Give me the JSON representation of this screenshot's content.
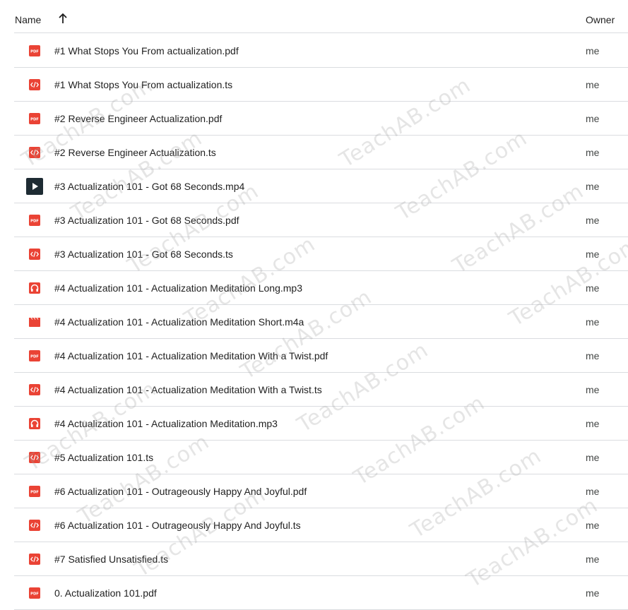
{
  "header": {
    "name_label": "Name",
    "owner_label": "Owner",
    "sort_icon": "arrow-up-icon"
  },
  "colors": {
    "pdf": "#ea4335",
    "code": "#ea4335",
    "audio": "#ea4335",
    "video_bg": "#1e2b33",
    "divider": "#dadce0"
  },
  "files": [
    {
      "name": "#1 What Stops You From actualization.pdf",
      "type": "pdf",
      "owner": "me"
    },
    {
      "name": "#1 What Stops You From actualization.ts",
      "type": "code",
      "owner": "me"
    },
    {
      "name": "#2 Reverse Engineer Actualization.pdf",
      "type": "pdf",
      "owner": "me"
    },
    {
      "name": "#2 Reverse Engineer Actualization.ts",
      "type": "code",
      "owner": "me"
    },
    {
      "name": "#3 Actualization 101 - Got 68 Seconds.mp4",
      "type": "video",
      "owner": "me"
    },
    {
      "name": "#3 Actualization 101 - Got 68 Seconds.pdf",
      "type": "pdf",
      "owner": "me"
    },
    {
      "name": "#3 Actualization 101 - Got 68 Seconds.ts",
      "type": "code",
      "owner": "me"
    },
    {
      "name": "#4 Actualization 101 - Actualization Meditation Long.mp3",
      "type": "audio",
      "owner": "me"
    },
    {
      "name": "#4 Actualization 101 - Actualization Meditation Short.m4a",
      "type": "clapper",
      "owner": "me"
    },
    {
      "name": "#4 Actualization 101 - Actualization Meditation With a Twist.pdf",
      "type": "pdf",
      "owner": "me"
    },
    {
      "name": "#4 Actualization 101 - Actualization Meditation With a Twist.ts",
      "type": "code",
      "owner": "me"
    },
    {
      "name": "#4 Actualization 101 - Actualization Meditation.mp3",
      "type": "audio",
      "owner": "me"
    },
    {
      "name": "#5 Actualization 101.ts",
      "type": "code",
      "owner": "me"
    },
    {
      "name": "#6 Actualization 101 - Outrageously Happy And Joyful.pdf",
      "type": "pdf",
      "owner": "me"
    },
    {
      "name": "#6 Actualization 101 - Outrageously Happy And Joyful.ts",
      "type": "code",
      "owner": "me"
    },
    {
      "name": "#7 Satisfied Unsatisfied.ts",
      "type": "code",
      "owner": "me"
    },
    {
      "name": "0. Actualization 101.pdf",
      "type": "pdf",
      "owner": "me"
    }
  ],
  "watermark_text": "TeachAB.com"
}
